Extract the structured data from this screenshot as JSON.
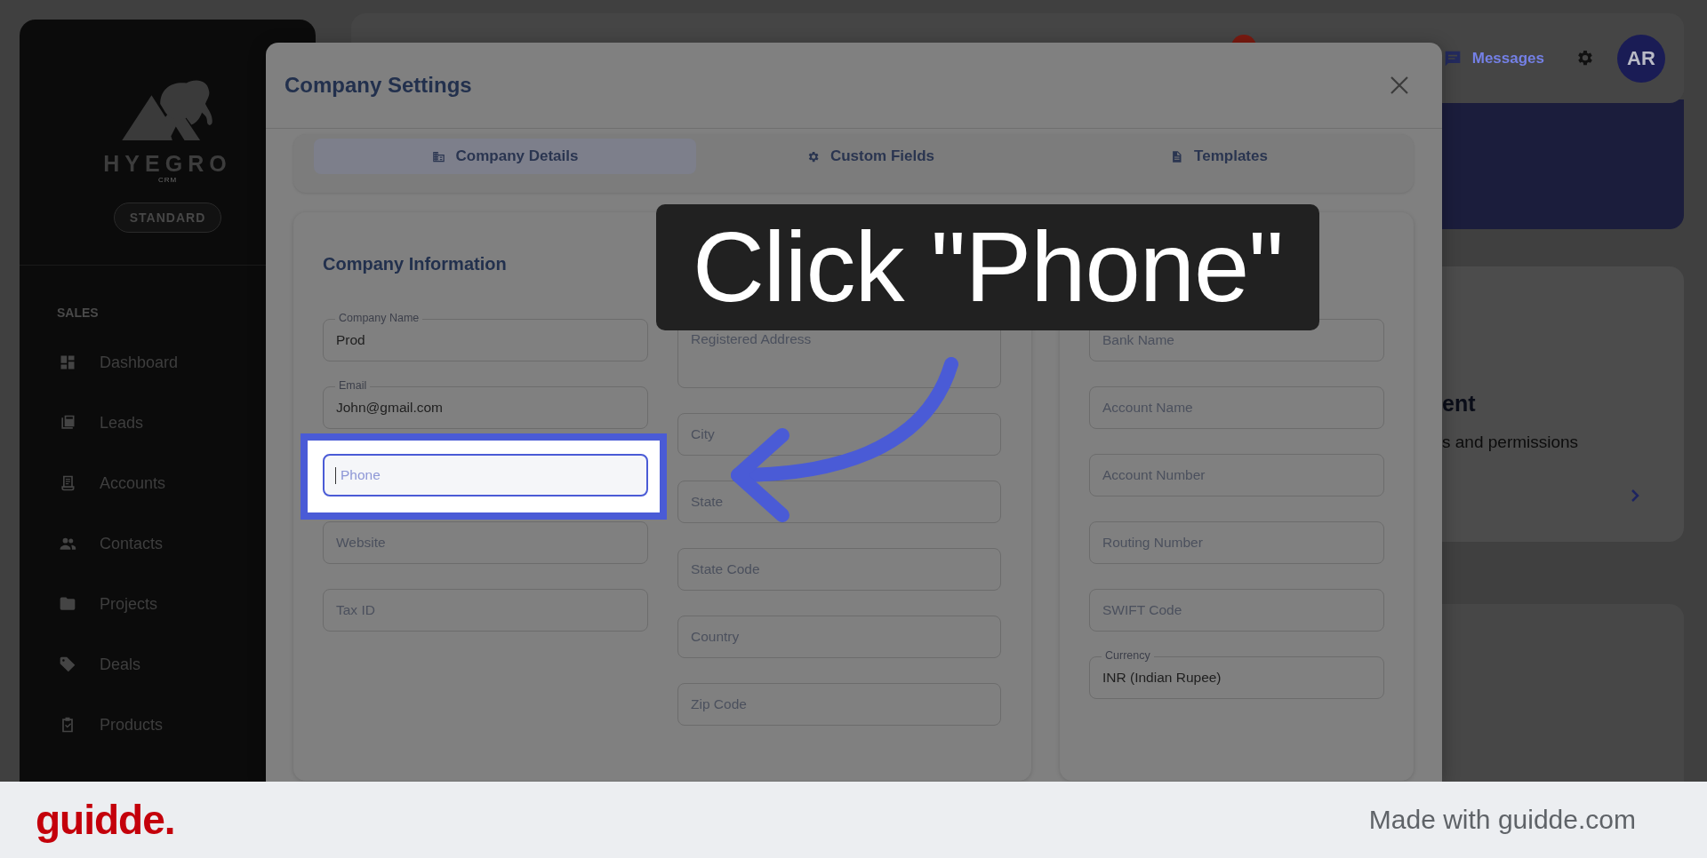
{
  "sidebar": {
    "brand": "HYEGRO",
    "brand_sub": "CRM",
    "plan": "STANDARD",
    "section": "SALES",
    "items": [
      {
        "label": "Dashboard"
      },
      {
        "label": "Leads"
      },
      {
        "label": "Accounts"
      },
      {
        "label": "Contacts"
      },
      {
        "label": "Projects"
      },
      {
        "label": "Deals"
      },
      {
        "label": "Products"
      }
    ]
  },
  "top_bar": {
    "messages": "Messages",
    "avatar": "AR"
  },
  "background_card": {
    "title": "ent",
    "text": "s and permissions"
  },
  "modal": {
    "title": "Company Settings",
    "tabs": [
      {
        "label": "Company Details",
        "selected": true
      },
      {
        "label": "Custom Fields",
        "selected": false
      },
      {
        "label": "Templates",
        "selected": false
      }
    ],
    "sections": [
      {
        "title": "Company Information",
        "columns": [
          {
            "fields": [
              {
                "label": "Company Name",
                "value": "Prod"
              },
              {
                "label": "Email",
                "value": "John@gmail.com"
              },
              {
                "placeholder": "Phone",
                "focused": true,
                "highlighted": true
              },
              {
                "placeholder": "Website"
              },
              {
                "placeholder": "Tax ID"
              }
            ]
          },
          {
            "fields": [
              {
                "placeholder": "Registered Address",
                "multiline": true
              },
              {
                "placeholder": "City"
              },
              {
                "placeholder": "State"
              },
              {
                "placeholder": "State Code"
              },
              {
                "placeholder": "Country"
              },
              {
                "placeholder": "Zip Code"
              }
            ]
          }
        ]
      },
      {
        "columns": [
          {
            "fields": [
              {
                "placeholder": "Bank Name"
              },
              {
                "placeholder": "Account Name"
              },
              {
                "placeholder": "Account Number"
              },
              {
                "placeholder": "Routing Number"
              },
              {
                "placeholder": "SWIFT Code"
              },
              {
                "label": "Currency",
                "value": "INR (Indian Rupee)"
              }
            ]
          }
        ]
      }
    ]
  },
  "callout": {
    "text": "Click \"Phone\""
  },
  "footer": {
    "logo": "guidde.",
    "credit": "Made with guidde.com"
  }
}
